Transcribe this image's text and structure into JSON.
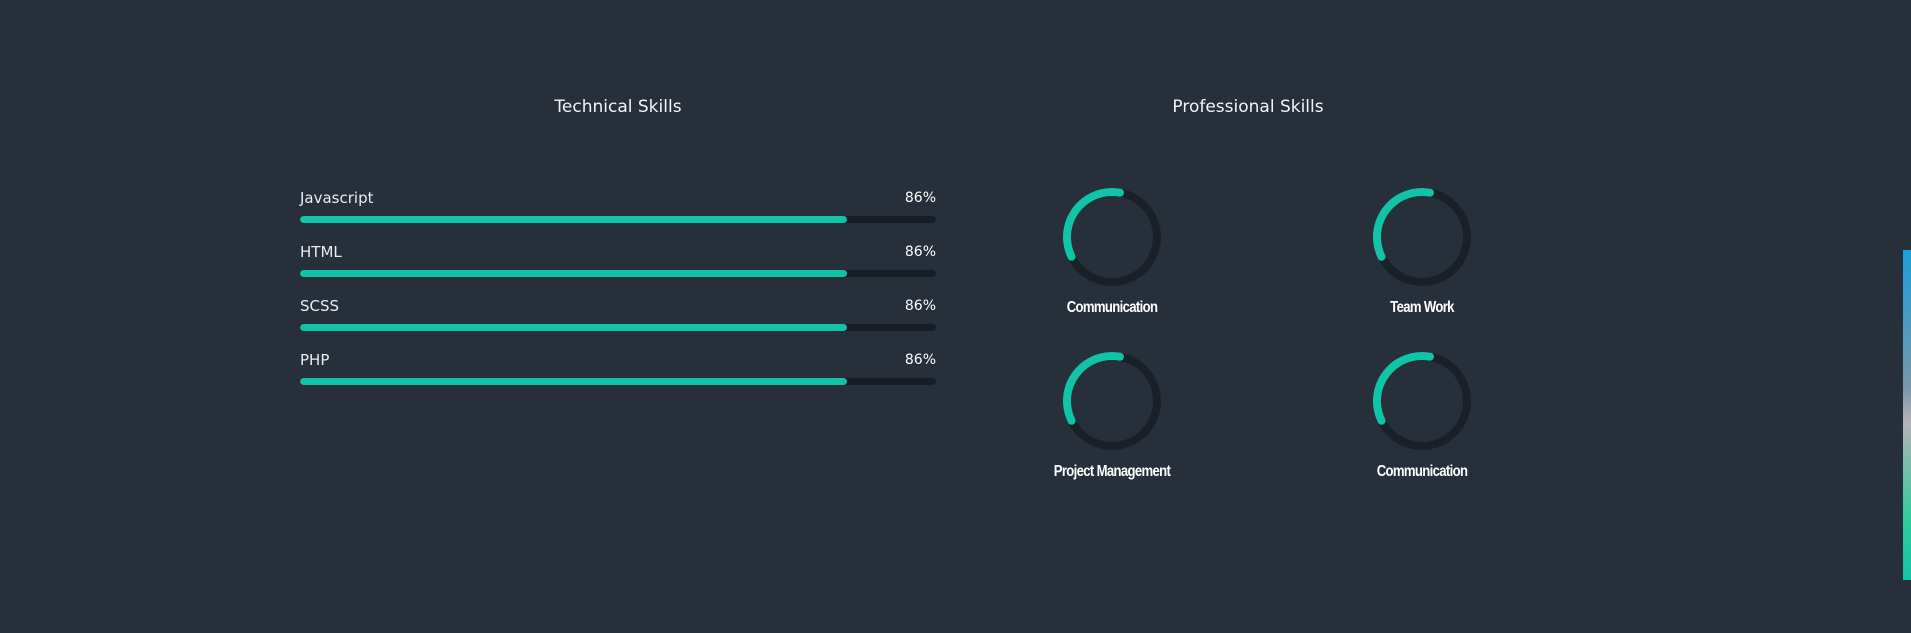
{
  "technical": {
    "title": "Technical Skills",
    "skills": [
      {
        "label": "Javascript",
        "percent_text": "86%",
        "value": 86
      },
      {
        "label": "HTML",
        "percent_text": "86%",
        "value": 86
      },
      {
        "label": "SCSS",
        "percent_text": "86%",
        "value": 86
      },
      {
        "label": "PHP",
        "percent_text": "86%",
        "value": 86
      }
    ]
  },
  "professional": {
    "title": "Professional Skills",
    "skills": [
      {
        "label": "Communication",
        "value": 0.35
      },
      {
        "label": "Team Work",
        "value": 0.35
      },
      {
        "label": "Project Management",
        "value": 0.35
      },
      {
        "label": "Communication",
        "value": 0.35
      }
    ]
  },
  "colors": {
    "background": "#262f3a",
    "accent": "#12c4a7",
    "track": "#171d24",
    "ring_track": "#1a2028"
  }
}
